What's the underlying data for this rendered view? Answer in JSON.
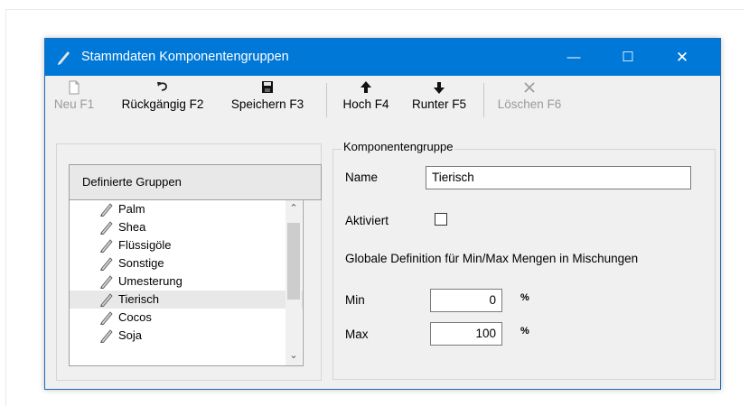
{
  "window": {
    "title": "Stammdaten Komponentengruppen",
    "controls": {
      "minimize": "—",
      "maximize": "☐",
      "close": "✕"
    },
    "accent_color": "#0078d7"
  },
  "toolbar": {
    "buttons": [
      {
        "label": "Neu F1",
        "icon": "new-document-icon",
        "enabled": false
      },
      {
        "label": "Rückgängig F2",
        "icon": "undo-icon",
        "enabled": true
      },
      {
        "label": "Speichern F3",
        "icon": "save-icon",
        "enabled": true
      },
      {
        "label": "Hoch F4",
        "icon": "move-up-icon",
        "enabled": true
      },
      {
        "label": "Runter F5",
        "icon": "move-down-icon",
        "enabled": true
      },
      {
        "label": "Löschen F6",
        "icon": "delete-icon",
        "enabled": false
      }
    ]
  },
  "groups": {
    "header": "Definierte Gruppen",
    "items": [
      "Palm",
      "Shea",
      "Flüssigöle",
      "Sonstige",
      "Umesterung",
      "Tierisch",
      "Cocos",
      "Soja"
    ],
    "selected": "Tierisch"
  },
  "details": {
    "legend": "Komponentengruppe",
    "name_label": "Name",
    "name_value": "Tierisch",
    "active_label": "Aktiviert",
    "active_checked": false,
    "global_text": "Globale Definition für Min/Max Mengen in Mischungen",
    "min_label": "Min",
    "min_value": "0",
    "max_label": "Max",
    "max_value": "100",
    "unit": "%"
  }
}
